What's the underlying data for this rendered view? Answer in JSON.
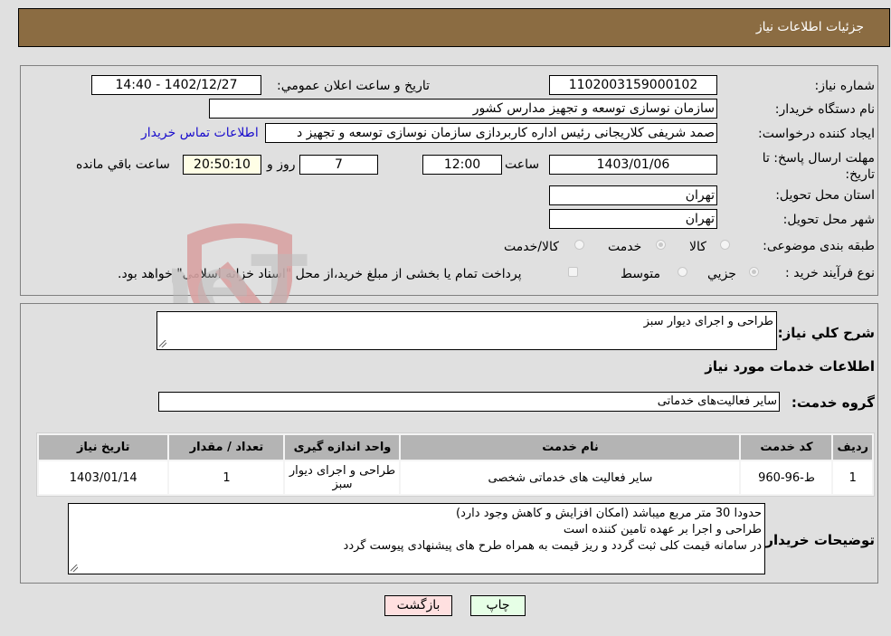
{
  "header": {
    "title": "جزئیات اطلاعات نیاز"
  },
  "form": {
    "need_number": {
      "label": "شماره نیاز:",
      "value": "1102003159000102"
    },
    "announce_datetime": {
      "label": "تاریخ و ساعت اعلان عمومي:",
      "value": "1402/12/27 - 14:40"
    },
    "buyer_org": {
      "label": "نام دستگاه خريدار:",
      "value": "سازمان نوسازی  توسعه و تجهیز مدارس کشور"
    },
    "requester": {
      "label": "ايجاد کننده درخواست:",
      "value": "صمد شریفی کلاریجانی رئیس اداره کاربردازی سازمان نوسازی  توسعه و تجهیز د"
    },
    "contact_link": "اطلاعات تماس خریدار",
    "deadline": {
      "label": "مهلت ارسال پاسخ: تا تاریخ:",
      "date": "1403/01/06",
      "time_label": "ساعت",
      "time": "12:00",
      "days": "7",
      "days_label": "روز و",
      "remaining": "20:50:10",
      "remaining_label": "ساعت باقي مانده"
    },
    "province": {
      "label": "استان محل تحویل:",
      "value": "تهران"
    },
    "city": {
      "label": "شهر محل تحویل:",
      "value": "تهران"
    },
    "category": {
      "label": "طبقه بندی موضوعی:",
      "options": [
        "کالا",
        "خدمت",
        "کالا/خدمت"
      ],
      "selected": "خدمت"
    },
    "process": {
      "label": "نوع فرآیند خرید :",
      "options": [
        "جزيي",
        "متوسط"
      ],
      "selected": "جزيي",
      "treasury_note": "پرداخت تمام یا بخشی از مبلغ خرید،از محل \"اسناد خزانه اسلامی\" خواهد بود."
    }
  },
  "details": {
    "summary_label": "شرح کلي نياز:",
    "summary_value": "طراحی و اجرای دیوار سبز",
    "services_heading": "اطلاعات خدمات مورد نياز",
    "service_group_label": "گروه خدمت:",
    "service_group_value": "سایر فعالیت‌های خدماتی",
    "table": {
      "headers": [
        "رديف",
        "کد خدمت",
        "نام خدمت",
        "واحد اندازه گيری",
        "تعداد / مقدار",
        "تاريخ نياز"
      ],
      "rows": [
        [
          "1",
          "ط-96-960",
          "سایر فعالیت های خدماتی شخصی",
          "طراحی و اجرای دیوار سبز",
          "1",
          "1403/01/14"
        ]
      ]
    },
    "buyer_notes_label": "توضيحات خريدار:",
    "buyer_notes": [
      "حدودا 30 متر مربع میباشد (امکان افزایش و کاهش وجود دارد)",
      "طراحی و اجرا بر عهده تامین کننده است",
      "در سامانه قیمت کلی ثبت گردد و ریز قیمت به همراه طرح های پیشنهادی پیوست گردد"
    ]
  },
  "buttons": {
    "print": "چاپ",
    "back": "بازگشت"
  },
  "watermark": "AriaTender.neT"
}
